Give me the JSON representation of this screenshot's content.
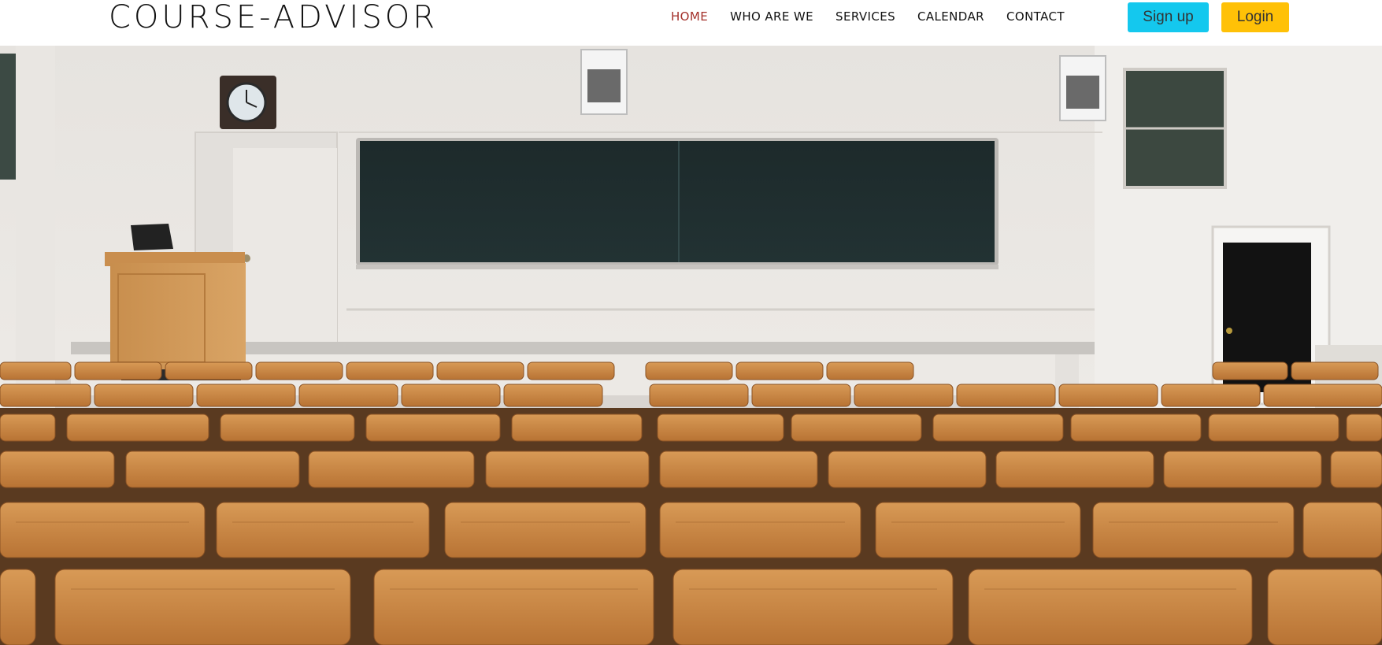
{
  "brand": {
    "name": "COURSE-ADVISOR"
  },
  "nav": {
    "items": [
      {
        "label": "HOME",
        "active": true
      },
      {
        "label": "WHO ARE WE",
        "active": false
      },
      {
        "label": "SERVICES",
        "active": false
      },
      {
        "label": "CALENDAR",
        "active": false
      },
      {
        "label": "CONTACT",
        "active": false
      }
    ],
    "signup_label": "Sign up",
    "login_label": "Login"
  },
  "colors": {
    "active_nav": "#a3302a",
    "signup_bg": "#14c8ee",
    "login_bg": "#ffc107"
  },
  "hero": {
    "subject": "lecture-hall-photo"
  }
}
